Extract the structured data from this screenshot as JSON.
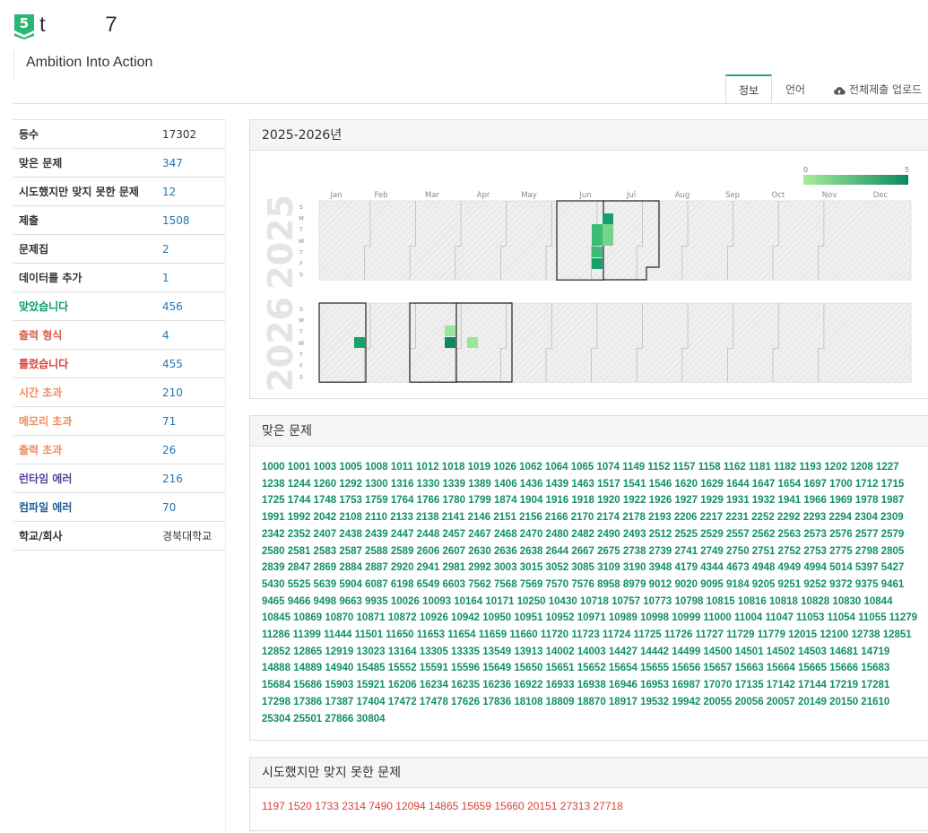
{
  "header": {
    "badge_level": "5",
    "user_name": "t          7",
    "subtitle": "Ambition Into Action"
  },
  "tabs": [
    {
      "label": "정보",
      "active": true
    },
    {
      "label": "언어",
      "active": false
    },
    {
      "label": "전체제출 업로드",
      "active": false,
      "icon": "cloud-upload-icon"
    }
  ],
  "stats": [
    {
      "k": "등수",
      "v": "17302",
      "kc": "#333",
      "vc": "#333"
    },
    {
      "k": "맞은 문제",
      "v": "347",
      "kc": "#333",
      "vc": "#2477b3"
    },
    {
      "k": "시도했지만 맞지 못한 문제",
      "v": "12",
      "kc": "#333",
      "vc": "#2477b3"
    },
    {
      "k": "제출",
      "v": "1508",
      "kc": "#333",
      "vc": "#2477b3"
    },
    {
      "k": "문제집",
      "v": "2",
      "kc": "#333",
      "vc": "#2477b3"
    },
    {
      "k": "데이터를 추가",
      "v": "1",
      "kc": "#333",
      "vc": "#2477b3"
    },
    {
      "k": "맞았습니다",
      "v": "456",
      "kc": "#0b9a6a",
      "vc": "#2477b3"
    },
    {
      "k": "출력 형식",
      "v": "4",
      "kc": "#e05a4e",
      "vc": "#2477b3"
    },
    {
      "k": "틀렸습니다",
      "v": "455",
      "kc": "#d9413a",
      "vc": "#2477b3"
    },
    {
      "k": "시간 초과",
      "v": "210",
      "kc": "#f08a5d",
      "vc": "#2477b3"
    },
    {
      "k": "메모리 초과",
      "v": "71",
      "kc": "#f08a5d",
      "vc": "#2477b3"
    },
    {
      "k": "출력 초과",
      "v": "26",
      "kc": "#f08a5d",
      "vc": "#2477b3"
    },
    {
      "k": "런타임 에러",
      "v": "216",
      "kc": "#5b3e96",
      "vc": "#2477b3"
    },
    {
      "k": "컴파일 에러",
      "v": "70",
      "kc": "#1f5d99",
      "vc": "#2477b3"
    },
    {
      "k": "학교/회사",
      "v": "경북대학교",
      "kc": "#333",
      "vc": "#333"
    }
  ],
  "heatmap": {
    "title": "2025-2026년",
    "legend_min": "0",
    "legend_max": "5",
    "months": [
      "Jan",
      "Feb",
      "Mar",
      "Apr",
      "May",
      "Jun",
      "Jul",
      "Aug",
      "Sep",
      "Oct",
      "Nov",
      "Dec"
    ],
    "weekdays": [
      "S",
      "M",
      "T",
      "W",
      "T",
      "F",
      "S"
    ],
    "years": [
      "2025",
      "2026"
    ],
    "colors": [
      "#9be59b",
      "#72d68a",
      "#3dbb76",
      "#18a06b",
      "#0b8a5e"
    ]
  },
  "solved": {
    "title": "맞은 문제",
    "list": "1000 1001 1003 1005 1008 1011 1012 1018 1019 1026 1062 1064 1065 1074 1149 1152 1157 1158 1162 1181 1182 1193 1202 1208 1227 1238 1244 1260 1292 1300 1316 1330 1339 1389 1406 1436 1439 1463 1517 1541 1546 1620 1629 1644 1647 1654 1697 1700 1712 1715 1725 1744 1748 1753 1759 1764 1766 1780 1799 1874 1904 1916 1918 1920 1922 1926 1927 1929 1931 1932 1941 1966 1969 1978 1987 1991 1992 2042 2108 2110 2133 2138 2141 2146 2151 2156 2166 2170 2174 2178 2193 2206 2217 2231 2252 2292 2293 2294 2304 2309 2342 2352 2407 2438 2439 2447 2448 2457 2467 2468 2470 2480 2482 2490 2493 2512 2525 2529 2557 2562 2563 2573 2576 2577 2579 2580 2581 2583 2587 2588 2589 2606 2607 2630 2636 2638 2644 2667 2675 2738 2739 2741 2749 2750 2751 2752 2753 2775 2798 2805 2839 2847 2869 2884 2887 2920 2941 2981 2992 3003 3015 3052 3085 3109 3190 3948 4179 4344 4673 4948 4949 4994 5014 5397 5427 5430 5525 5639 5904 6087 6198 6549 6603 7562 7568 7569 7570 7576 8958 8979 9012 9020 9095 9184 9205 9251 9252 9372 9375 9461 9465 9466 9498 9663 9935 10026 10093 10164 10171 10250 10430 10718 10757 10773 10798 10815 10816 10818 10828 10830 10844 10845 10869 10870 10871 10872 10926 10942 10950 10951 10952 10971 10989 10998 10999 11000 11004 11047 11053 11054 11055 11279 11286 11399 11444 11501 11650 11653 11654 11659 11660 11720 11723 11724 11725 11726 11727 11729 11779 12015 12100 12738 12851 12852 12865 12919 13023 13164 13305 13335 13549 13913 14002 14003 14427 14442 14499 14500 14501 14502 14503 14681 14719 14888 14889 14940 15485 15552 15591 15596 15649 15650 15651 15652 15654 15655 15656 15657 15663 15664 15665 15666 15683 15684 15686 15903 15921 16206 16234 16235 16236 16922 16933 16938 16946 16953 16987 17070 17135 17142 17144 17219 17281 17298 17386 17387 17404 17472 17478 17626 17836 18108 18809 18870 18917 19532 19942 20055 20056 20057 20149 20150 21610 25304 25501 27866 30804"
  },
  "failed": {
    "title": "시도했지만 맞지 못한 문제",
    "list": "1197 1520 1733 2314 7490 12094 14865 15659 15660 20151 27313 27718"
  }
}
